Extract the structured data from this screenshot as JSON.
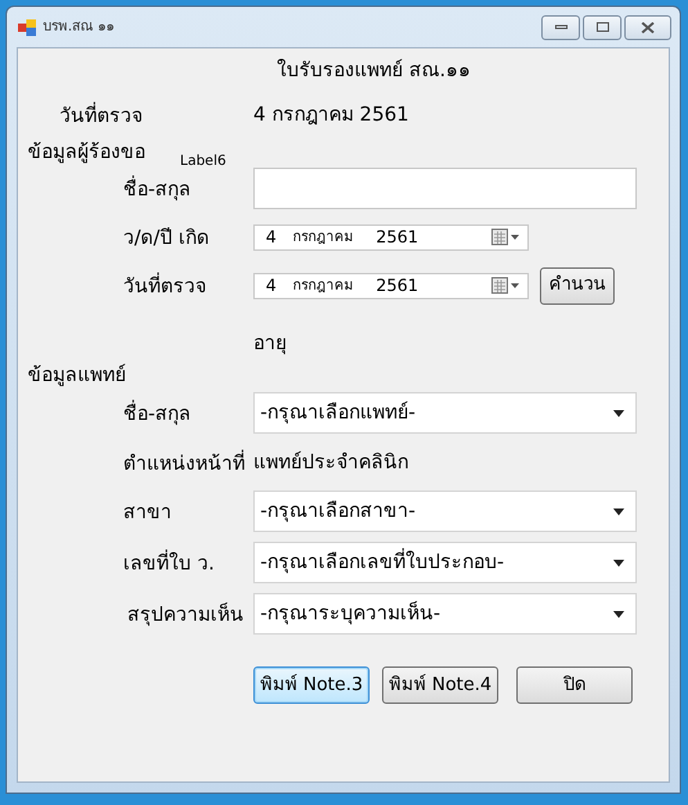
{
  "window": {
    "title": "บรพ.สณ ๑๑"
  },
  "form_title": "ใบรับรองแพทย์ สณ.๑๑",
  "exam_date": {
    "label": "วันที่ตรวจ",
    "value": "4 กรกฎาคม 2561"
  },
  "requester": {
    "heading": "ข้อมูลผู้ร้องขอ",
    "note": "Label6",
    "name": {
      "label": "ชื่อ-สกุล"
    },
    "birth_date": {
      "label": "ว/ด/ปี เกิด",
      "day": "4",
      "month": "กรกฎาคม",
      "year": "2561"
    },
    "check_date": {
      "label": "วันที่ตรวจ",
      "day": "4",
      "month": "กรกฎาคม",
      "year": "2561"
    },
    "calculate_button": "คำนวน",
    "age_label": "อายุ"
  },
  "doctor": {
    "heading": "ข้อมูลแพทย์",
    "name": {
      "label": "ชื่อ-สกุล",
      "value": "-กรุณาเลือกแพทย์-"
    },
    "position": {
      "label": "ตำแหน่งหน้าที่",
      "value": "แพทย์ประจำคลินิก"
    },
    "branch": {
      "label": "สาขา",
      "value": "-กรุณาเลือกสาขา-"
    },
    "license": {
      "label": "เลขที่ใบ ว.",
      "value": "-กรุณาเลือกเลขที่ใบประกอบ-"
    },
    "opinion": {
      "label": "สรุปความเห็น",
      "value": "-กรุณาระบุความเห็น-"
    }
  },
  "buttons": [
    {
      "label": "พิมพ์ Note.3",
      "focused": true
    },
    {
      "label": "พิมพ์ Note.4",
      "focused": false
    },
    {
      "label": "ปิด",
      "focused": false
    }
  ]
}
